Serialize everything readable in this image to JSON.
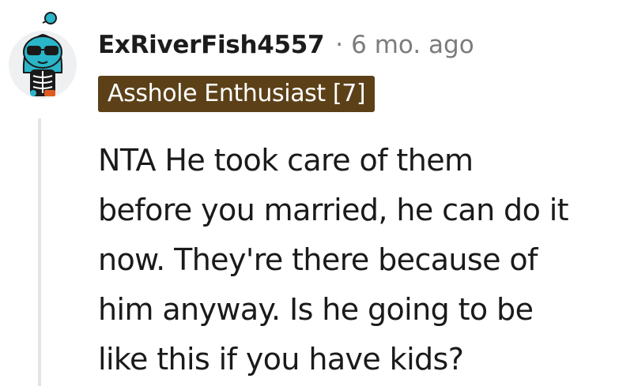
{
  "comment": {
    "author": "ExRiverFish4557",
    "separator": "·",
    "timestamp": "6 mo. ago",
    "flair": "Asshole Enthusiast [7]",
    "body_lines": [
      "NTA He took care of them",
      "before you married, he can do it",
      "now. They're there because of",
      "him anyway. Is he going to be",
      "like this if you have kids?"
    ]
  },
  "colors": {
    "flair_background": "#5c4118",
    "flair_text": "#ffffff",
    "timestamp": "#7c7c7c",
    "thread_line": "#e4e4e4",
    "avatar_teal": "#2bb5c9",
    "avatar_background": "#eef0f2"
  }
}
